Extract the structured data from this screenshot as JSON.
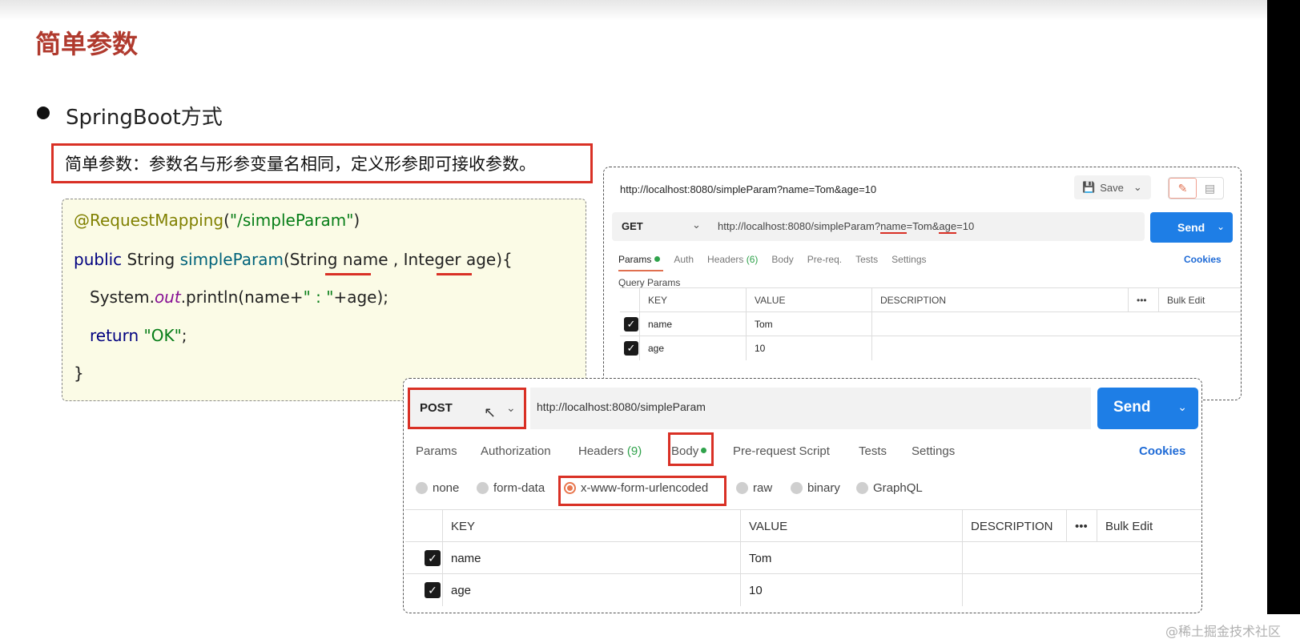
{
  "slide": {
    "title": "简单参数",
    "heading": "SpringBoot方式",
    "description": "简单参数：参数名与形参变量名相同，定义形参即可接收参数。",
    "watermark": "@稀土掘金技术社区"
  },
  "code": {
    "line1": {
      "annotation": "@RequestMapping",
      "p1": "(",
      "str": "\"/simpleParam\"",
      "p2": ")"
    },
    "line2": {
      "kw": "public",
      "t1": " String ",
      "fn": "simpleParam",
      "t2": "(String ",
      "param1": "name",
      "t3": " , Integer ",
      "param2": "age",
      "t4": "){"
    },
    "line3": {
      "t1": "System.",
      "it": "out",
      "t2": ".println(name+",
      "str": "\" : \"",
      "t3": "+age);"
    },
    "line4": {
      "kw": "return",
      "sp": " ",
      "str": "\"OK\"",
      "t1": ";"
    },
    "line5": "}"
  },
  "get_panel": {
    "title_url": "http://localhost:8080/simpleParam?name=Tom&age=10",
    "save_label": "Save",
    "method": "GET",
    "url_prefix": "http://localhost:8080/simpleParam?",
    "url_k1": "name",
    "url_v1": "=Tom&",
    "url_k2": "age",
    "url_v2": "=10",
    "send_label": "Send",
    "tabs": {
      "params": "Params",
      "auth": "Auth",
      "headers": "Headers ",
      "headers_count": "(6)",
      "body": "Body",
      "prereq": "Pre-req.",
      "tests": "Tests",
      "settings": "Settings"
    },
    "cookies": "Cookies",
    "query_params_label": "Query Params",
    "columns": {
      "key": "KEY",
      "value": "VALUE",
      "description": "DESCRIPTION",
      "more": "•••",
      "bulk": "Bulk Edit"
    },
    "rows": [
      {
        "key": "name",
        "value": "Tom"
      },
      {
        "key": "age",
        "value": "10"
      }
    ]
  },
  "post_panel": {
    "method": "POST",
    "url": "http://localhost:8080/simpleParam",
    "send_label": "Send",
    "tabs": {
      "params": "Params",
      "authorization": "Authorization",
      "headers": "Headers ",
      "headers_count": "(9)",
      "body": "Body",
      "prerequest": "Pre-request Script",
      "tests": "Tests",
      "settings": "Settings"
    },
    "cookies": "Cookies",
    "body_types": {
      "none": "none",
      "form_data": "form-data",
      "urlencoded": "x-www-form-urlencoded",
      "raw": "raw",
      "binary": "binary",
      "graphql": "GraphQL"
    },
    "selected_body_type": "x-www-form-urlencoded",
    "columns": {
      "key": "KEY",
      "value": "VALUE",
      "description": "DESCRIPTION",
      "more": "•••",
      "bulk": "Bulk Edit"
    },
    "rows": [
      {
        "key": "name",
        "value": "Tom"
      },
      {
        "key": "age",
        "value": "10"
      }
    ]
  },
  "colors": {
    "accent_red": "#d93025",
    "title_red": "#b03a2e",
    "send_blue": "#1e7ee6",
    "status_green": "#2fa24b"
  }
}
